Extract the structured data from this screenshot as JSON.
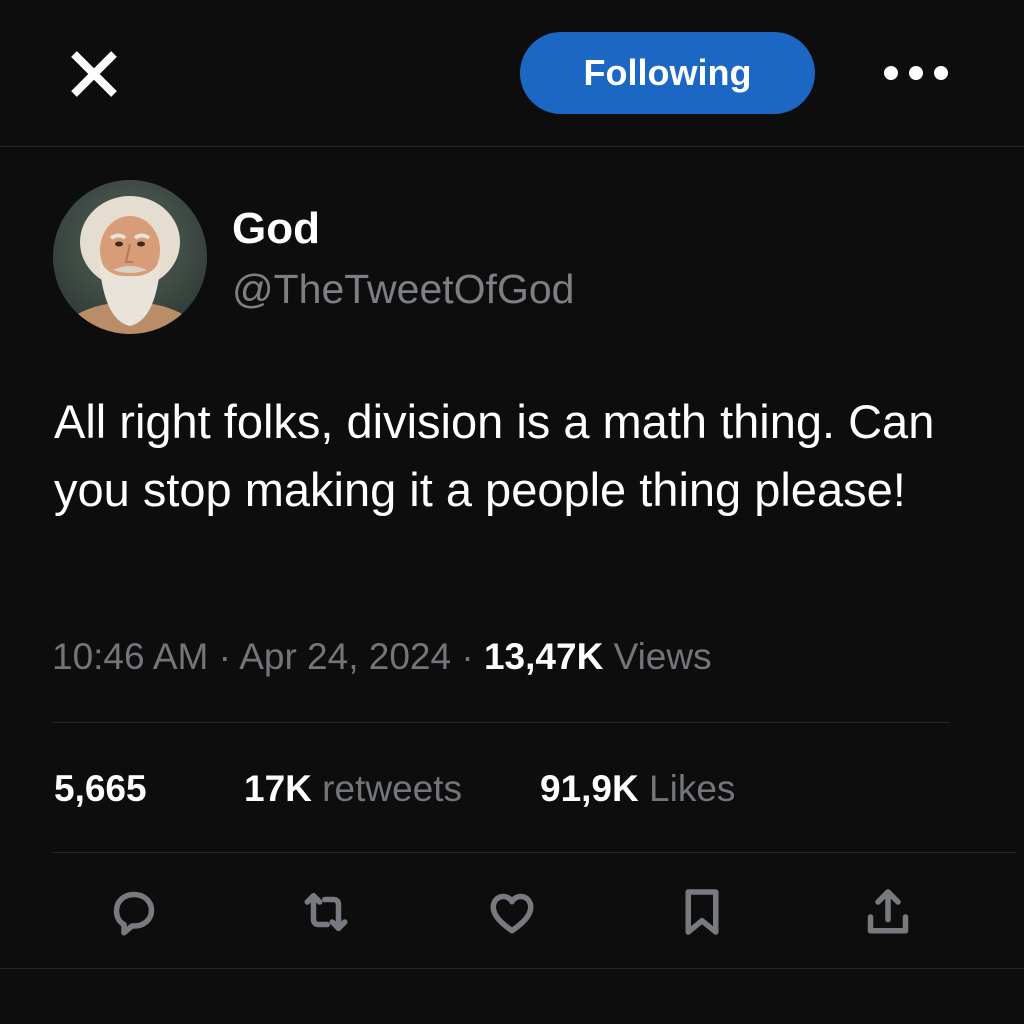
{
  "header": {
    "logo_icon": "x-logo-icon",
    "follow_label": "Following",
    "follow_color": "#1d67c4",
    "more_icon": "more-dots-icon"
  },
  "author": {
    "name": "God",
    "handle": "@TheTweetOfGod"
  },
  "tweet": {
    "text": "All right folks, division is a math thing. Can you stop making it a people thing please!",
    "time": "10:46 AM",
    "sep1": "·",
    "date": "Apr 24, 2024",
    "sep2": "·",
    "views_count": "13,47K",
    "views_label": "Views"
  },
  "stats": {
    "replies_count": "5,665",
    "retweets_count": "17K",
    "retweets_label": "retweets",
    "likes_count": "91,9K",
    "likes_label": "Likes"
  },
  "actions": [
    "reply-icon",
    "retweet-icon",
    "like-icon",
    "bookmark-icon",
    "share-icon"
  ],
  "colors": {
    "background": "#0d0d0d",
    "muted_text": "#72767a",
    "icon": "#777b80"
  }
}
